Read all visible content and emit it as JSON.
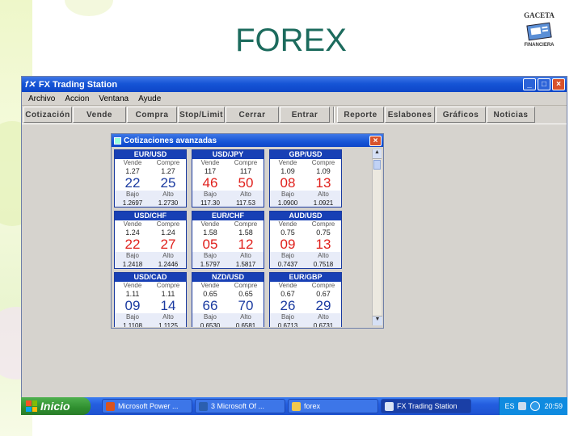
{
  "slide": {
    "title": "FOREX"
  },
  "logo": {
    "top": "GACETA",
    "bottom": "FINANCIERA"
  },
  "window": {
    "title": "FX Trading Station",
    "icon": "fx-app-icon",
    "buttons": {
      "minimize": "_",
      "maximize": "□",
      "close": "×"
    }
  },
  "menu": [
    "Archivo",
    "Accion",
    "Ventana",
    "Ayude"
  ],
  "toolbar": [
    "Cotización",
    "Vende",
    "Compra",
    "Stop/Limit",
    "Cerrar",
    "Entrar",
    "Reporte",
    "Eslabones",
    "Gráficos",
    "Noticias"
  ],
  "dialog": {
    "title": "Cotizaciones avanzadas",
    "close": "×",
    "tiles": [
      {
        "pair": "EUR/USD",
        "sell_label": "Vende",
        "buy_label": "Compre",
        "sell_small": "1.27",
        "buy_small": "1.27",
        "sell_big": "22",
        "buy_big": "25",
        "low_label": "Bajo",
        "high_label": "Alto",
        "low": "1.2697",
        "high": "1.2730",
        "sell_red": false,
        "buy_red": false
      },
      {
        "pair": "USD/JPY",
        "sell_label": "Vende",
        "buy_label": "Compre",
        "sell_small": "117",
        "buy_small": "117",
        "sell_big": "46",
        "buy_big": "50",
        "low_label": "Bajo",
        "high_label": "Alto",
        "low": "117.30",
        "high": "117.53",
        "sell_red": true,
        "buy_red": true
      },
      {
        "pair": "GBP/USD",
        "sell_label": "Vende",
        "buy_label": "Compre",
        "sell_small": "1.09",
        "buy_small": "1.09",
        "sell_big": "08",
        "buy_big": "13",
        "low_label": "Bajo",
        "high_label": "Alto",
        "low": "1.0900",
        "high": "1.0921",
        "sell_red": true,
        "buy_red": true
      },
      {
        "pair": "USD/CHF",
        "sell_label": "Vende",
        "buy_label": "Compre",
        "sell_small": "1.24",
        "buy_small": "1.24",
        "sell_big": "22",
        "buy_big": "27",
        "low_label": "Bajo",
        "high_label": "Alto",
        "low": "1.2418",
        "high": "1.2446",
        "sell_red": true,
        "buy_red": true
      },
      {
        "pair": "EUR/CHF",
        "sell_label": "Vende",
        "buy_label": "Compre",
        "sell_small": "1.58",
        "buy_small": "1.58",
        "sell_big": "05",
        "buy_big": "12",
        "low_label": "Bajo",
        "high_label": "Alto",
        "low": "1.5797",
        "high": "1.5817",
        "sell_red": true,
        "buy_red": true
      },
      {
        "pair": "AUD/USD",
        "sell_label": "Vende",
        "buy_label": "Compre",
        "sell_small": "0.75",
        "buy_small": "0.75",
        "sell_big": "09",
        "buy_big": "13",
        "low_label": "Bajo",
        "high_label": "Alto",
        "low": "0.7437",
        "high": "0.7518",
        "sell_red": true,
        "buy_red": true
      },
      {
        "pair": "USD/CAD",
        "sell_label": "Vende",
        "buy_label": "Compre",
        "sell_small": "1.11",
        "buy_small": "1.11",
        "sell_big": "09",
        "buy_big": "14",
        "low_label": "Bajo",
        "high_label": "Alto",
        "low": "1.1108",
        "high": "1.1125",
        "sell_red": false,
        "buy_red": false
      },
      {
        "pair": "NZD/USD",
        "sell_label": "Vende",
        "buy_label": "Compre",
        "sell_small": "0.65",
        "buy_small": "0.65",
        "sell_big": "66",
        "buy_big": "70",
        "low_label": "Bajo",
        "high_label": "Alto",
        "low": "0.6530",
        "high": "0.6581",
        "sell_red": false,
        "buy_red": false
      },
      {
        "pair": "EUR/GBP",
        "sell_label": "Vende",
        "buy_label": "Compre",
        "sell_small": "0.67",
        "buy_small": "0.67",
        "sell_big": "26",
        "buy_big": "29",
        "low_label": "Bajo",
        "high_label": "Alto",
        "low": "0.6713",
        "high": "0.6731",
        "sell_red": false,
        "buy_red": false
      }
    ]
  },
  "taskbar": {
    "start": "Inicio",
    "tasks": [
      {
        "label": "Microsoft Power ...",
        "icon": "powerpoint-icon",
        "color": "#d9531e",
        "active": false
      },
      {
        "label": "3 Microsoft Of ...",
        "icon": "word-icon",
        "color": "#2b5fb0",
        "active": false
      },
      {
        "label": "forex",
        "icon": "folder-icon",
        "color": "#f2c94c",
        "active": false
      },
      {
        "label": "FX Trading Station",
        "icon": "fx-app-icon",
        "color": "#dbe4f5",
        "active": true
      }
    ],
    "tray": {
      "lang": "ES",
      "clock": "20:59"
    }
  }
}
